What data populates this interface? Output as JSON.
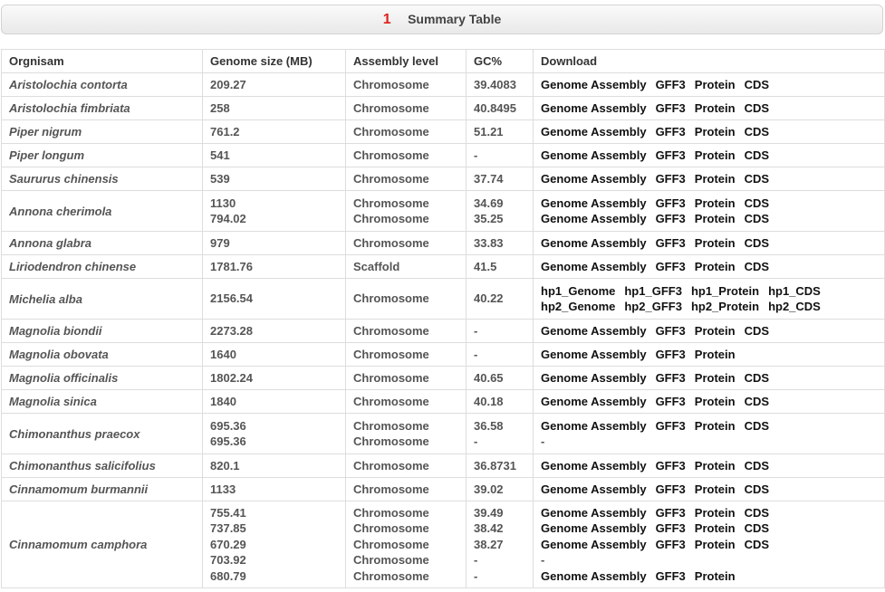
{
  "header": {
    "number": "1",
    "title": "Summary Table"
  },
  "columns": [
    "Orgnisam",
    "Genome size (MB)",
    "Assembly level",
    "GC%",
    "Download"
  ],
  "rows": [
    {
      "organism": "Aristolochia contorta",
      "h": 26,
      "sub": [
        {
          "size": "209.27",
          "level": "Chromosome",
          "gc": "39.4083",
          "links": [
            "Genome Assembly",
            "GFF3",
            "Protein",
            "CDS"
          ]
        }
      ]
    },
    {
      "organism": "Aristolochia fimbriata",
      "h": 26,
      "sub": [
        {
          "size": "258",
          "level": "Chromosome",
          "gc": "40.8495",
          "links": [
            "Genome Assembly",
            "GFF3",
            "Protein",
            "CDS"
          ]
        }
      ]
    },
    {
      "organism": "Piper nigrum",
      "h": 26,
      "sub": [
        {
          "size": "761.2",
          "level": "Chromosome",
          "gc": "51.21",
          "links": [
            "Genome Assembly",
            "GFF3",
            "Protein",
            "CDS"
          ]
        }
      ]
    },
    {
      "organism": "Piper longum",
      "h": 26,
      "sub": [
        {
          "size": "541",
          "level": "Chromosome",
          "gc": "-",
          "links": [
            "Genome Assembly",
            "GFF3",
            "Protein",
            "CDS"
          ]
        }
      ]
    },
    {
      "organism": "Saururus chinensis",
      "h": 26,
      "sub": [
        {
          "size": "539",
          "level": "Chromosome",
          "gc": "37.74",
          "links": [
            "Genome Assembly",
            "GFF3",
            "Protein",
            "CDS"
          ]
        }
      ]
    },
    {
      "organism": "Annona cherimola",
      "h": 45,
      "sub": [
        {
          "size": "1130",
          "level": "Chromosome",
          "gc": "34.69",
          "links": [
            "Genome Assembly",
            "GFF3",
            "Protein",
            "CDS"
          ]
        },
        {
          "size": "794.02",
          "level": "Chromosome",
          "gc": "35.25",
          "links": [
            "Genome Assembly",
            "GFF3",
            "Protein",
            "CDS"
          ]
        }
      ]
    },
    {
      "organism": "Annona glabra",
      "h": 26,
      "sub": [
        {
          "size": "979",
          "level": "Chromosome",
          "gc": "33.83",
          "links": [
            "Genome Assembly",
            "GFF3",
            "Protein",
            "CDS"
          ]
        }
      ]
    },
    {
      "organism": "Liriodendron chinense",
      "h": 26,
      "sub": [
        {
          "size": "1781.76",
          "level": "Scaffold",
          "gc": "41.5",
          "links": [
            "Genome Assembly",
            "GFF3",
            "Protein",
            "CDS"
          ]
        }
      ]
    },
    {
      "organism": "Michelia alba",
      "h": 45,
      "sub": [
        {
          "size": "2156.54",
          "level": "Chromosome",
          "gc": "40.22",
          "links": [
            "hp1_Genome",
            "hp1_GFF3",
            "hp1_Protein",
            "hp1_CDS"
          ],
          "links2": [
            "hp2_Genome",
            "hp2_GFF3",
            "hp2_Protein",
            "hp2_CDS"
          ]
        }
      ]
    },
    {
      "organism": "Magnolia biondii",
      "h": 26,
      "sub": [
        {
          "size": "2273.28",
          "level": "Chromosome",
          "gc": "-",
          "links": [
            "Genome Assembly",
            "GFF3",
            "Protein",
            "CDS"
          ]
        }
      ]
    },
    {
      "organism": "Magnolia obovata",
      "h": 26,
      "sub": [
        {
          "size": "1640",
          "level": "Chromosome",
          "gc": "-",
          "links": [
            "Genome Assembly",
            "GFF3",
            "Protein"
          ]
        }
      ]
    },
    {
      "organism": "Magnolia officinalis",
      "h": 26,
      "sub": [
        {
          "size": "1802.24",
          "level": "Chromosome",
          "gc": "40.65",
          "links": [
            "Genome Assembly",
            "GFF3",
            "Protein",
            "CDS"
          ]
        }
      ]
    },
    {
      "organism": "Magnolia sinica",
      "h": 26,
      "sub": [
        {
          "size": "1840",
          "level": "Chromosome",
          "gc": "40.18",
          "links": [
            "Genome Assembly",
            "GFF3",
            "Protein",
            "CDS"
          ]
        }
      ]
    },
    {
      "organism": "Chimonanthus praecox",
      "h": 45,
      "sub": [
        {
          "size": "695.36",
          "level": "Chromosome",
          "gc": "36.58",
          "links": [
            "Genome Assembly",
            "GFF3",
            "Protein",
            "CDS"
          ]
        },
        {
          "size": "695.36",
          "level": "Chromosome",
          "gc": "-",
          "links": [
            "-"
          ]
        }
      ]
    },
    {
      "organism": "Chimonanthus salicifolius",
      "h": 26,
      "sub": [
        {
          "size": "820.1",
          "level": "Chromosome",
          "gc": "36.8731",
          "links": [
            "Genome Assembly",
            "GFF3",
            "Protein",
            "CDS"
          ]
        }
      ]
    },
    {
      "organism": "Cinnamomum burmannii",
      "h": 26,
      "sub": [
        {
          "size": "1133",
          "level": "Chromosome",
          "gc": "39.02",
          "links": [
            "Genome Assembly",
            "GFF3",
            "Protein",
            "CDS"
          ]
        }
      ]
    },
    {
      "organism": "Cinnamomum camphora",
      "h": 96,
      "sub": [
        {
          "size": "755.41",
          "level": "Chromosome",
          "gc": "39.49",
          "links": [
            "Genome Assembly",
            "GFF3",
            "Protein",
            "CDS"
          ]
        },
        {
          "size": "737.85",
          "level": "Chromosome",
          "gc": "38.42",
          "links": [
            "Genome Assembly",
            "GFF3",
            "Protein",
            "CDS"
          ]
        },
        {
          "size": "670.29",
          "level": "Chromosome",
          "gc": "38.27",
          "links": [
            "Genome Assembly",
            "GFF3",
            "Protein",
            "CDS"
          ]
        },
        {
          "size": "703.92",
          "level": "Chromosome",
          "gc": "-",
          "links": [
            "-"
          ]
        },
        {
          "size": "680.79",
          "level": "Chromosome",
          "gc": "-",
          "links": [
            "Genome Assembly",
            "GFF3",
            "Protein"
          ]
        }
      ]
    }
  ]
}
